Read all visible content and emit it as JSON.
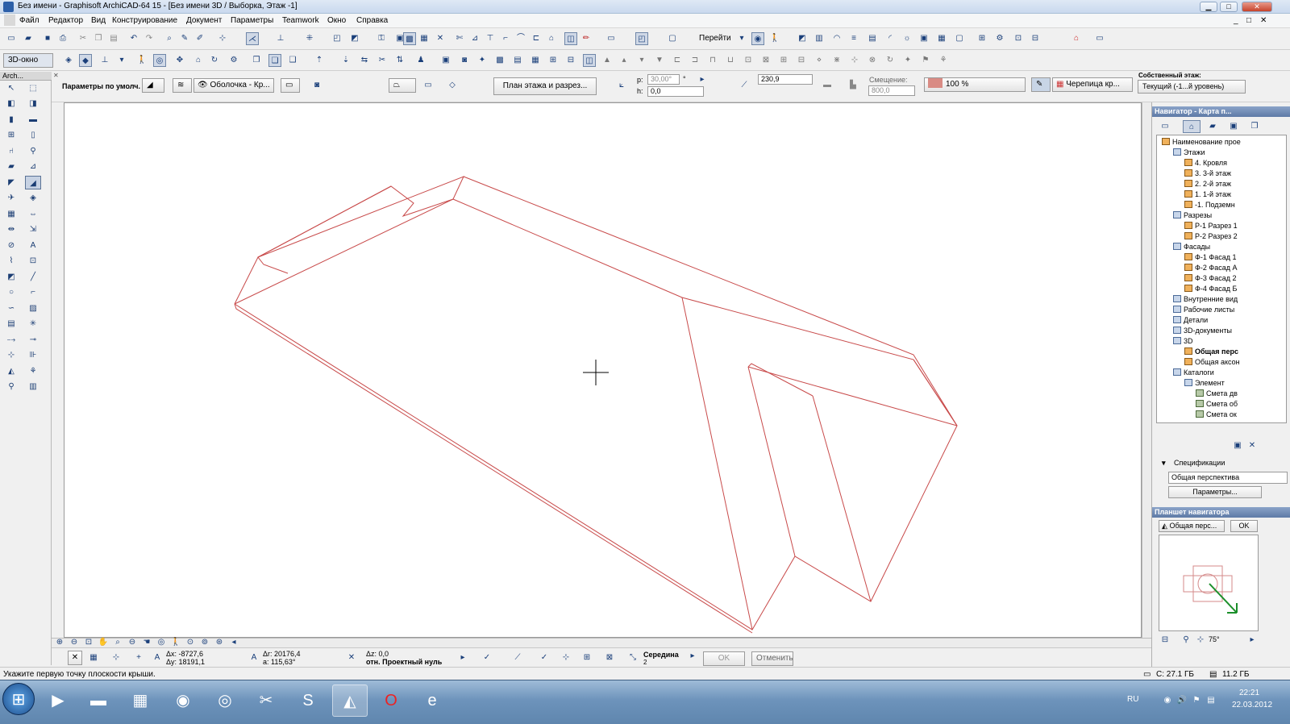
{
  "window": {
    "title": "Без имени - Graphisoft ArchiCAD-64 15 - [Без имени 3D / Выборка, Этаж -1]",
    "min": "▁",
    "max": "□",
    "close": "✕",
    "dmin": "_",
    "dmax": "□",
    "dclose": "✕"
  },
  "menu": [
    "Файл",
    "Редактор",
    "Вид",
    "Конструирование",
    "Документ",
    "Параметры",
    "Teamwork",
    "Окно",
    "Справка"
  ],
  "toolbar1": {
    "goto_label": "Перейти"
  },
  "toolbar2": {
    "view3d_label": "3D-окно"
  },
  "infobox": {
    "params_label": "Параметры по умолч.",
    "shell_label": "Оболочка - Кр...",
    "plan_section_label": "План этажа и разрез...",
    "angle_label": "p:",
    "angle_value": "30,00°",
    "deg": "°",
    "h_label": "h:",
    "h_value": "0,0",
    "thickness_value": "230,9",
    "offset_label": "Смещение:",
    "offset_value": "800,0",
    "opacity_value": "100 %",
    "material_label": "Черепица кр...",
    "home_story_title": "Собственный этаж:",
    "home_story_value": "Текущий (-1...й уровень)"
  },
  "toolbox": {
    "title": "Arch..."
  },
  "navigator": {
    "title": "Навигатор - Карта п...",
    "tree": [
      {
        "label": "Наименование прое",
        "level": 0,
        "icon": "house"
      },
      {
        "label": "Этажи",
        "level": 1,
        "icon": "folder"
      },
      {
        "label": "4. Кровля",
        "level": 2,
        "icon": "story"
      },
      {
        "label": "3. 3-й этаж",
        "level": 2,
        "icon": "story"
      },
      {
        "label": "2. 2-й этаж",
        "level": 2,
        "icon": "story"
      },
      {
        "label": "1. 1-й этаж",
        "level": 2,
        "icon": "story"
      },
      {
        "label": "-1. Подземн",
        "level": 2,
        "icon": "story"
      },
      {
        "label": "Разрезы",
        "level": 1,
        "icon": "folder"
      },
      {
        "label": "Р-1 Разрез 1",
        "level": 2,
        "icon": "story"
      },
      {
        "label": "Р-2 Разрез 2",
        "level": 2,
        "icon": "story"
      },
      {
        "label": "Фасады",
        "level": 1,
        "icon": "folder"
      },
      {
        "label": "Ф-1 Фасад 1",
        "level": 2,
        "icon": "story"
      },
      {
        "label": "Ф-2 Фасад А",
        "level": 2,
        "icon": "story"
      },
      {
        "label": "Ф-3 Фасад 2",
        "level": 2,
        "icon": "story"
      },
      {
        "label": "Ф-4 Фасад Б",
        "level": 2,
        "icon": "story"
      },
      {
        "label": "Внутренние вид",
        "level": 1,
        "icon": "folder"
      },
      {
        "label": "Рабочие листы",
        "level": 1,
        "icon": "folder"
      },
      {
        "label": "Детали",
        "level": 1,
        "icon": "folder"
      },
      {
        "label": "3D-документы",
        "level": 1,
        "icon": "folder"
      },
      {
        "label": "3D",
        "level": 1,
        "icon": "folder"
      },
      {
        "label": "Общая перс",
        "level": 2,
        "icon": "camera",
        "bold": true
      },
      {
        "label": "Общая аксон",
        "level": 2,
        "icon": "camera"
      },
      {
        "label": "Каталоги",
        "level": 1,
        "icon": "folder"
      },
      {
        "label": "Элемент",
        "level": 2,
        "icon": "folder"
      },
      {
        "label": "Смета дв",
        "level": 3,
        "icon": "sheet"
      },
      {
        "label": "Смета об",
        "level": 3,
        "icon": "sheet"
      },
      {
        "label": "Смета ок",
        "level": 3,
        "icon": "sheet"
      }
    ],
    "spec_label": "Спецификации",
    "spec_value": "Общая перспектива",
    "params_button": "Параметры..."
  },
  "preview": {
    "title": "Планшет навигатора",
    "view_label": "Общая перс...",
    "ok": "OK",
    "angle": "75°"
  },
  "coords": {
    "dx": "Δx: -8727,6",
    "dy": "Δy: 18191,1",
    "dr": "Δr: 20176,4",
    "a": "a: 115,63°",
    "dz": "Δz: 0,0",
    "ref": "отн. Проектный нуль",
    "snap_label": "Середина",
    "snap_num": "2",
    "ok": "OK",
    "cancel": "Отменить"
  },
  "status": {
    "hint": "Укажите первую точку плоскости крыши.",
    "c_drive": "С: 27.1 ГБ",
    "mem": "11.2 ГБ"
  },
  "taskbar": {
    "lang": "RU",
    "time": "22:21",
    "date": "22.03.2012"
  },
  "colors": {
    "roof_line": "#c84a4a",
    "accent": "#1a3f7a"
  }
}
